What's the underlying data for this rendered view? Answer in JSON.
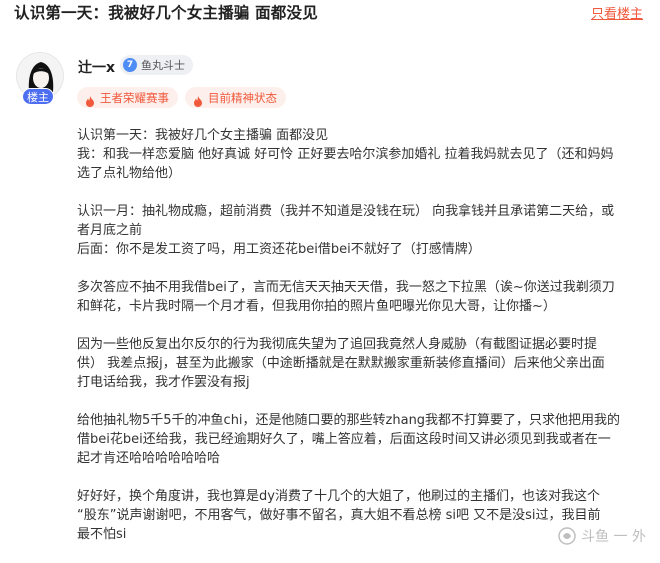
{
  "post": {
    "title": "认识第一天：我被好几个女主播骗 面都没见",
    "op_only_link": "只看楼主"
  },
  "author": {
    "name": "辻一x",
    "level_number": "7",
    "level_name": "鱼丸斗士",
    "op_badge": "楼主",
    "tags": [
      {
        "label": "王者荣耀赛事",
        "icon": "flame-icon"
      },
      {
        "label": "目前精神状态",
        "icon": "flame-icon"
      }
    ]
  },
  "content": {
    "paragraphs": [
      [
        "认识第一天：我被好几个女主播骗 面都没见",
        "我：和我一样恋爱脑 他好真诚 好可怜 正好要去哈尔滨参加婚礼 拉着我妈就去见了（还和妈妈",
        "选了点礼物给他）"
      ],
      [
        "认识一月：抽礼物成瘾，超前消费（我并不知道是没钱在玩） 向我拿钱并且承诺第二天给，或",
        "者月底之前",
        "后面：你不是发工资了吗，用工资还花bei借bei不就好了（打感情牌）"
      ],
      [
        "多次答应不抽不用我借bei了，言而无信天天抽天天借，我一怒之下拉黑（诶~你送过我剃须刀",
        "和鲜花，卡片我时隔一个月才看，但我用你拍的照片鱼吧曝光你见大哥，让你播~）"
      ],
      [
        "因为一些他反复出尔反尔的行为我彻底失望为了追回我竟然人身威胁（有截图证据必要时提",
        "供） 我差点报j，甚至为此搬家（中途断播就是在默默搬家重新装修直播间）后来他父亲出面",
        "打电话给我，我才作罢没有报j"
      ],
      [
        "给他抽礼物5千5千的冲鱼chi，还是他随口要的那些转zhang我都不打算要了，只求他把用我的",
        "借bei花bei还给我，我已经逾期好久了，嘴上答应着，后面这段时间又讲必须见到我或者在一",
        "起才肯还哈哈哈哈哈哈哈"
      ],
      [
        "好好好，换个角度讲，我也算是dy消费了十几个的大姐了，他刷过的主播们，也该对我这个",
        "“股东”说声谢谢吧，不用客气，做好事不留名，真大姐不看总榜 si吧 又不是没si过，我目前",
        "最不怕si"
      ]
    ]
  },
  "watermark": {
    "text": "斗鱼 一 外",
    "icon": "fish-logo-icon"
  },
  "colors": {
    "accent": "#f0593c",
    "tag_bg": "#fdf0ec",
    "op_badge": "#4e6ef2",
    "level": "#4e8cf6"
  }
}
